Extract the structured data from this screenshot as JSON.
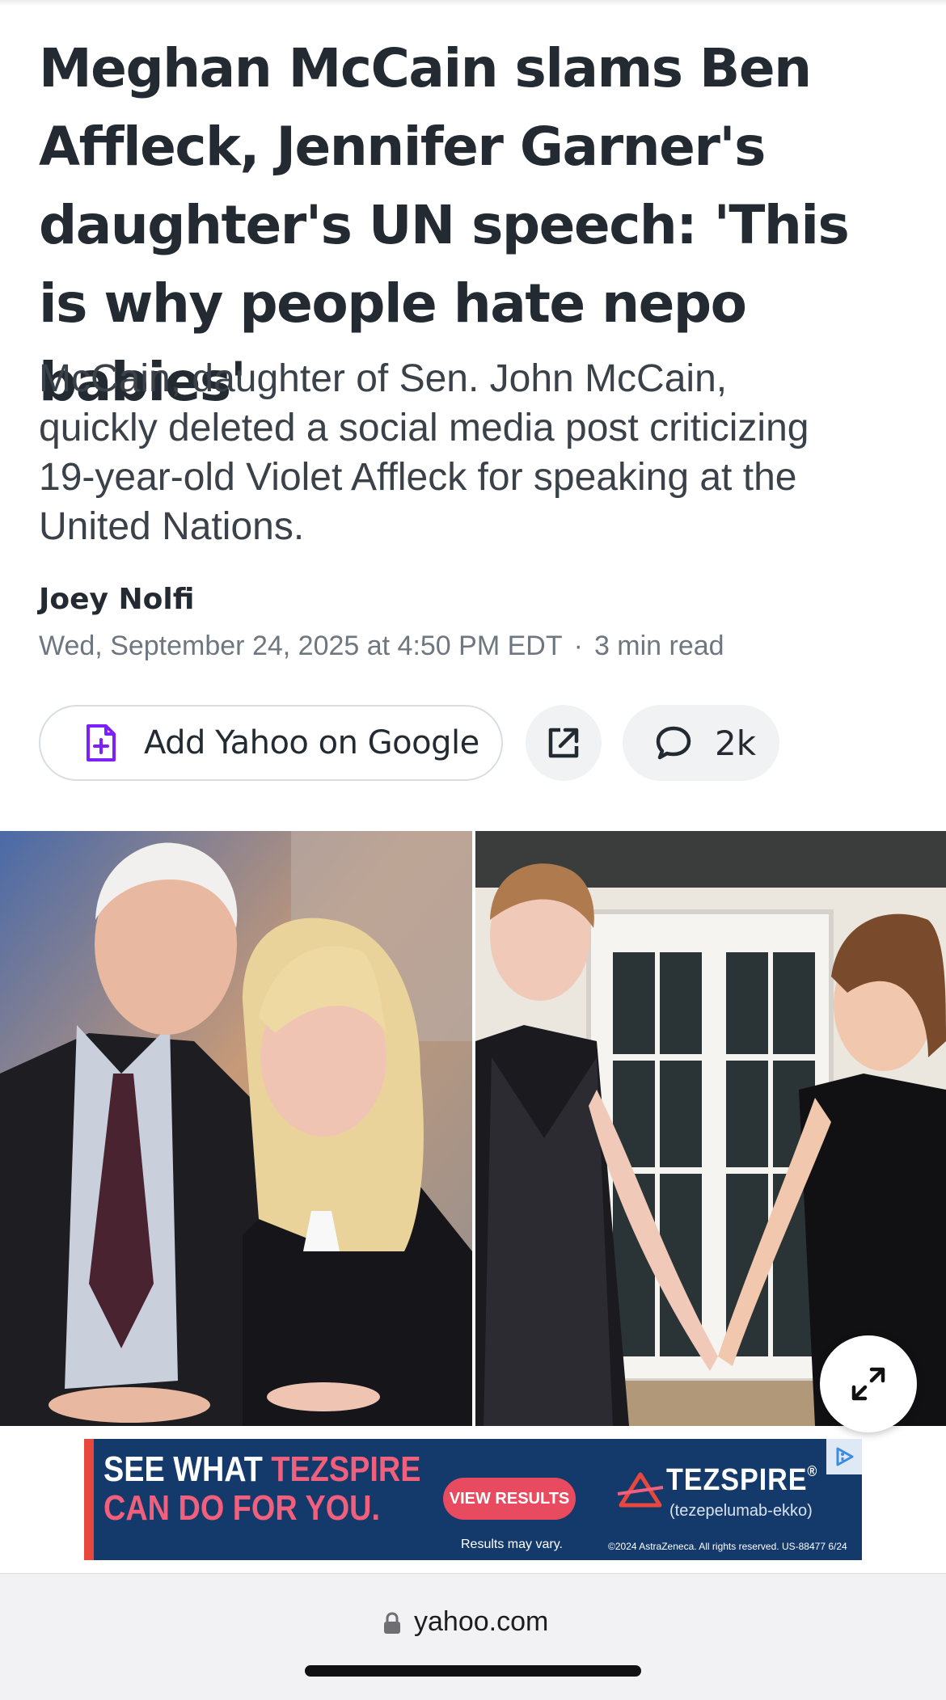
{
  "article": {
    "headline": "Meghan McCain slams Ben Affleck, Jennifer Garner's daughter's UN speech: 'This is why people hate nepo babies'",
    "summary": "McCain, daughter of Sen. John McCain, quickly deleted a social media post criticizing 19-year-old Violet Affleck for speaking at the United Nations.",
    "author": "Joey Nolfi",
    "date": "Wed, September 24, 2025 at 4:50 PM EDT",
    "separator": "·",
    "read_time": "3 min read"
  },
  "actions": {
    "add_google_label": "Add Yahoo on Google",
    "comment_count": "2k"
  },
  "ad": {
    "line1_prefix": "SEE WHAT ",
    "line1_brand": "TEZSPIRE",
    "line2": "CAN DO FOR YOU.",
    "cta": "VIEW RESULTS",
    "disclaimer": "Results may vary.",
    "logo_text": "TEZSPIRE",
    "logo_trademark": "®",
    "logo_sub": "(tezepelumab-ekko)",
    "legal": "©2024 AstraZeneca. All rights reserved. US-88477 6/24"
  },
  "browser": {
    "domain": "yahoo.com"
  },
  "colors": {
    "accent_purple": "#7e1fff",
    "ad_navy": "#14396b",
    "ad_pink": "#f0607c"
  }
}
